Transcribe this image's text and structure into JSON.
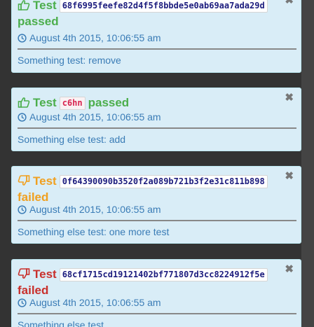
{
  "cards": [
    {
      "label": "Test",
      "hash": "68f6995feefe82d4f5f8bbde5e0ab69aa7ada29d",
      "status": "passed",
      "date": "August 4th 2015, 10:06:55 am",
      "message": "Something test: remove",
      "close": "✖"
    },
    {
      "label": "Test",
      "hash": "c6hn",
      "status": "passed",
      "date": "August 4th 2015, 10:06:55 am",
      "message": "Something else test: add",
      "close": "✖"
    },
    {
      "label": "Test",
      "hash": "0f64390090b3520f2a089b721b3f2e31c811b898",
      "status": "failed",
      "date": "August 4th 2015, 10:06:55 am",
      "message": "Something else test: one more test",
      "close": "✖"
    },
    {
      "label": "Test",
      "hash": "68cf1715cd19121402bf771807d3cc8224912f5e",
      "status": "failed",
      "date": "August 4th 2015, 10:06:55 am",
      "message": "Something else test",
      "close": "✖"
    }
  ],
  "colors": {
    "background": "#333333",
    "card": "#d9edf7",
    "passed": "#4cae4c",
    "failed_warning": "#f0a020",
    "failed_error": "#c9302c",
    "link": "#3a7cb6"
  },
  "icons": {
    "passed": "thumbs-up-icon",
    "failed": "thumbs-down-icon",
    "date": "clock-icon",
    "close": "close-icon"
  }
}
